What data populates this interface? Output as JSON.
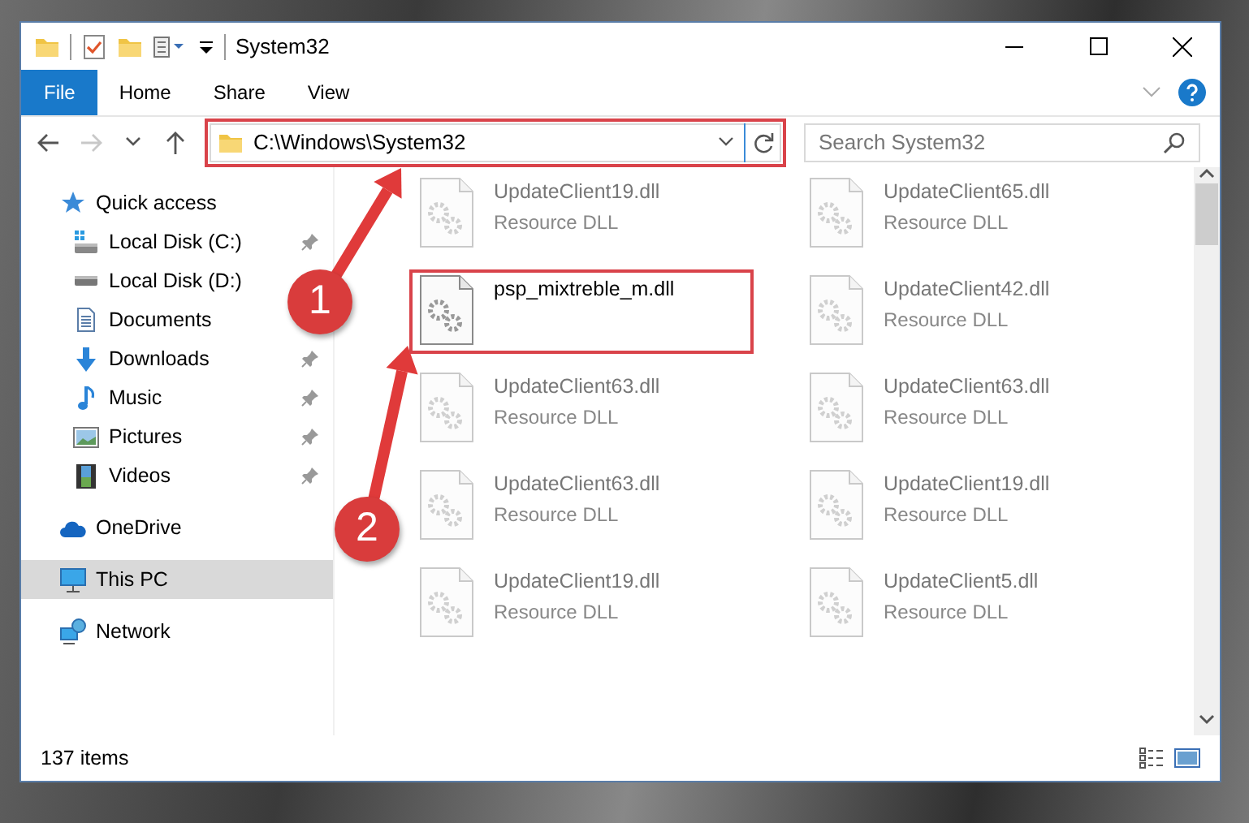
{
  "window": {
    "title": "System32"
  },
  "ribbon_tabs": [
    {
      "label": "File",
      "kind": "file"
    },
    {
      "label": "Home",
      "kind": "tab"
    },
    {
      "label": "Share",
      "kind": "tab"
    },
    {
      "label": "View",
      "kind": "tab"
    }
  ],
  "nav_buttons": [
    {
      "kind": "back",
      "disabled": false
    },
    {
      "kind": "forward",
      "disabled": true
    },
    {
      "kind": "recent",
      "disabled": false
    },
    {
      "kind": "up",
      "disabled": false
    }
  ],
  "address": {
    "path": "C:\\Windows\\System32"
  },
  "search": {
    "placeholder": "Search System32"
  },
  "sidebar": {
    "items": [
      {
        "label": "Quick access",
        "kind": "star",
        "selected": false,
        "children": [
          {
            "label": "Local Disk (C:)",
            "kind": "drive-c",
            "pinned": true,
            "selected": false
          },
          {
            "label": "Local Disk (D:)",
            "kind": "drive",
            "pinned": false,
            "selected": false
          },
          {
            "label": "Documents",
            "kind": "documents",
            "pinned": false,
            "selected": false
          },
          {
            "label": "Downloads",
            "kind": "downloads",
            "pinned": true,
            "selected": false
          },
          {
            "label": "Music",
            "kind": "music",
            "pinned": true,
            "selected": false
          },
          {
            "label": "Pictures",
            "kind": "pictures",
            "pinned": true,
            "selected": false
          },
          {
            "label": "Videos",
            "kind": "videos",
            "pinned": true,
            "selected": false
          }
        ]
      },
      {
        "label": "OneDrive",
        "kind": "cloud",
        "selected": false
      },
      {
        "label": "This PC",
        "kind": "pc",
        "selected": true
      },
      {
        "label": "Network",
        "kind": "network",
        "selected": false
      }
    ]
  },
  "files": [
    {
      "name": "UpdateClient19.dll",
      "type": "Resource DLL",
      "blurred": true
    },
    {
      "name": "UpdateClient65.dll",
      "type": "Resource DLL",
      "blurred": true
    },
    {
      "name": "psp_mixtreble_m.dll",
      "blurred": false
    },
    {
      "name": "UpdateClient42.dll",
      "type": "Resource DLL",
      "blurred": true
    },
    {
      "name": "UpdateClient63.dll",
      "type": "Resource DLL",
      "blurred": true
    },
    {
      "name": "UpdateClient63.dll",
      "type": "Resource DLL",
      "blurred": true
    },
    {
      "name": "UpdateClient63.dll",
      "type": "Resource DLL",
      "blurred": true
    },
    {
      "name": "UpdateClient19.dll",
      "type": "Resource DLL",
      "blurred": true
    },
    {
      "name": "UpdateClient19.dll",
      "type": "Resource DLL",
      "blurred": true
    },
    {
      "name": "UpdateClient5.dll",
      "type": "Resource DLL",
      "blurred": true
    }
  ],
  "status_bar": {
    "count": "137 items"
  },
  "annotations": [
    {
      "label": "1"
    },
    {
      "label": "2"
    }
  ]
}
